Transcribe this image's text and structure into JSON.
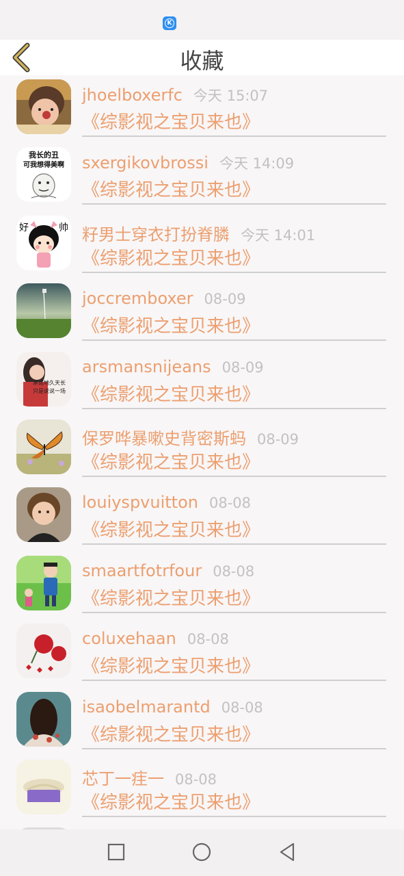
{
  "header": {
    "title": "收藏"
  },
  "favorites": [
    {
      "username": "jhoelboxerfc",
      "time": "今天 15:07",
      "work": "《综影视之宝贝来也》"
    },
    {
      "username": "sxergikovbrossi",
      "time": "今天 14:09",
      "work": "《综影视之宝贝来也》"
    },
    {
      "username": "籽男士穿衣打扮脊膦",
      "time": "今天 14:01",
      "work": "《综影视之宝贝来也》"
    },
    {
      "username": "joccremboxer",
      "time": "08-09",
      "work": "《综影视之宝贝来也》"
    },
    {
      "username": "arsmansnijeans",
      "time": "08-09",
      "work": "《综影视之宝贝来也》"
    },
    {
      "username": "保罗哗暴嗽史背密斯蚂",
      "time": "08-09",
      "work": "《综影视之宝贝来也》"
    },
    {
      "username": "louiyspvuitton",
      "time": "08-08",
      "work": "《综影视之宝贝来也》"
    },
    {
      "username": "smaartfotrfour",
      "time": "08-08",
      "work": "《综影视之宝贝来也》"
    },
    {
      "username": "coluxehaan",
      "time": "08-08",
      "work": "《综影视之宝贝来也》"
    },
    {
      "username": "isaobelmarantd",
      "time": "08-08",
      "work": "《综影视之宝贝来也》"
    },
    {
      "username": "芯丁一疰一",
      "time": "08-08",
      "work": "《综影视之宝贝来也》"
    }
  ],
  "avatar_texts": {
    "avatar2_line1": "我长的丑",
    "avatar2_line2": "可我想得美啊",
    "avatar3_left": "好",
    "avatar3_right": "帅",
    "avatar5_line1": "承诺地久天长",
    "avatar5_line2": "只是说说一场"
  },
  "colors": {
    "accent": "#ec9f6f",
    "time_gray": "#c2c2c2",
    "divider": "#cfcfcf",
    "back_arrow": "#d2b45a"
  },
  "icons": {
    "back": "chevron-left-icon",
    "app_badge": "k-app-icon",
    "nav_recent": "square-icon",
    "nav_home": "circle-icon",
    "nav_back": "triangle-back-icon"
  }
}
